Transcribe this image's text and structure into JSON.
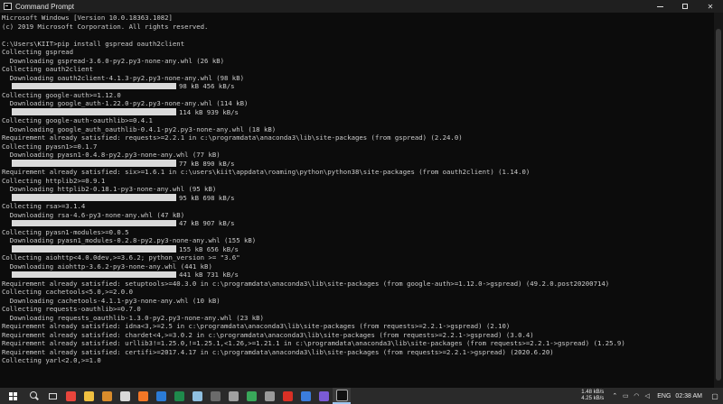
{
  "window": {
    "title": "Command Prompt",
    "minimize_icon": "minimize-icon",
    "maximize_icon": "maximize-icon",
    "close_label": "✕"
  },
  "console": {
    "lines": [
      {
        "text": "Microsoft Windows [Version 10.0.18363.1082]"
      },
      {
        "text": "(c) 2019 Microsoft Corporation. All rights reserved."
      },
      {
        "text": ""
      },
      {
        "text": "C:\\Users\\KIIT>pip install gspread oauth2client"
      },
      {
        "text": "Collecting gspread"
      },
      {
        "text": "  Downloading gspread-3.6.0-py2.py3-none-any.whl (26 kB)"
      },
      {
        "text": "Collecting oauth2client"
      },
      {
        "text": "  Downloading oauth2client-4.1.3-py2.py3-none-any.whl (98 kB)"
      },
      {
        "progress": true,
        "text": "98 kB 456 kB/s"
      },
      {
        "text": "Collecting google-auth>=1.12.0"
      },
      {
        "text": "  Downloading google_auth-1.22.0-py2.py3-none-any.whl (114 kB)"
      },
      {
        "progress": true,
        "text": "114 kB 939 kB/s"
      },
      {
        "text": "Collecting google-auth-oauthlib>=0.4.1"
      },
      {
        "text": "  Downloading google_auth_oauthlib-0.4.1-py2.py3-none-any.whl (18 kB)"
      },
      {
        "text": "Requirement already satisfied: requests>=2.2.1 in c:\\programdata\\anaconda3\\lib\\site-packages (from gspread) (2.24.0)"
      },
      {
        "text": "Collecting pyasn1>=0.1.7"
      },
      {
        "text": "  Downloading pyasn1-0.4.8-py2.py3-none-any.whl (77 kB)"
      },
      {
        "progress": true,
        "text": "77 kB 890 kB/s"
      },
      {
        "text": "Requirement already satisfied: six>=1.6.1 in c:\\users\\kiit\\appdata\\roaming\\python\\python38\\site-packages (from oauth2client) (1.14.0)"
      },
      {
        "text": "Collecting httplib2>=0.9.1"
      },
      {
        "text": "  Downloading httplib2-0.18.1-py3-none-any.whl (95 kB)"
      },
      {
        "progress": true,
        "text": "95 kB 698 kB/s"
      },
      {
        "text": "Collecting rsa>=3.1.4"
      },
      {
        "text": "  Downloading rsa-4.6-py3-none-any.whl (47 kB)"
      },
      {
        "progress": true,
        "text": "47 kB 907 kB/s"
      },
      {
        "text": "Collecting pyasn1-modules>=0.0.5"
      },
      {
        "text": "  Downloading pyasn1_modules-0.2.8-py2.py3-none-any.whl (155 kB)"
      },
      {
        "progress": true,
        "text": "155 kB 656 kB/s"
      },
      {
        "text": "Collecting aiohttp<4.0.0dev,>=3.6.2; python_version >= \"3.6\""
      },
      {
        "text": "  Downloading aiohttp-3.6.2-py3-none-any.whl (441 kB)"
      },
      {
        "progress": true,
        "text": "441 kB 731 kB/s"
      },
      {
        "text": "Requirement already satisfied: setuptools>=40.3.0 in c:\\programdata\\anaconda3\\lib\\site-packages (from google-auth>=1.12.0->gspread) (49.2.0.post20200714)"
      },
      {
        "text": "Collecting cachetools<5.0,>=2.0.0"
      },
      {
        "text": "  Downloading cachetools-4.1.1-py3-none-any.whl (10 kB)"
      },
      {
        "text": "Collecting requests-oauthlib>=0.7.0"
      },
      {
        "text": "  Downloading requests_oauthlib-1.3.0-py2.py3-none-any.whl (23 kB)"
      },
      {
        "text": "Requirement already satisfied: idna<3,>=2.5 in c:\\programdata\\anaconda3\\lib\\site-packages (from requests>=2.2.1->gspread) (2.10)"
      },
      {
        "text": "Requirement already satisfied: chardet<4,>=3.0.2 in c:\\programdata\\anaconda3\\lib\\site-packages (from requests>=2.2.1->gspread) (3.0.4)"
      },
      {
        "text": "Requirement already satisfied: urllib3!=1.25.0,!=1.25.1,<1.26,>=1.21.1 in c:\\programdata\\anaconda3\\lib\\site-packages (from requests>=2.2.1->gspread) (1.25.9)"
      },
      {
        "text": "Requirement already satisfied: certifi>=2017.4.17 in c:\\programdata\\anaconda3\\lib\\site-packages (from requests>=2.2.1->gspread) (2020.6.20)"
      },
      {
        "text": "Collecting yarl<2.0,>=1.0"
      }
    ]
  },
  "taskbar": {
    "apps": [
      {
        "name": "chrome-app",
        "color": "#e8453c"
      },
      {
        "name": "file-explorer-app",
        "color": "#f0c040"
      },
      {
        "name": "files-app",
        "color": "#d98c2b"
      },
      {
        "name": "store-app",
        "color": "#d9d9d9"
      },
      {
        "name": "jupyter-app",
        "color": "#f37726"
      },
      {
        "name": "vscode-app",
        "color": "#2b7bd6"
      },
      {
        "name": "excel-app",
        "color": "#1f8a4c"
      },
      {
        "name": "notepad-app",
        "color": "#8fbfe0"
      },
      {
        "name": "photos-app",
        "color": "#6b6b6b"
      },
      {
        "name": "rocket-app",
        "color": "#a0a0a0"
      },
      {
        "name": "green-app",
        "color": "#39a85a"
      },
      {
        "name": "settings-app",
        "color": "#9a9a9a"
      },
      {
        "name": "red-app",
        "color": "#d93025"
      },
      {
        "name": "blue-app",
        "color": "#3b7ddd"
      },
      {
        "name": "media-app",
        "color": "#7b5bd6"
      },
      {
        "name": "command-prompt-app",
        "color": "#111111"
      }
    ],
    "tray": {
      "upload_speed": "1.48 kB/s",
      "download_speed": "4.25 kB/s",
      "language": "ENG",
      "time": "02:38 AM"
    }
  }
}
